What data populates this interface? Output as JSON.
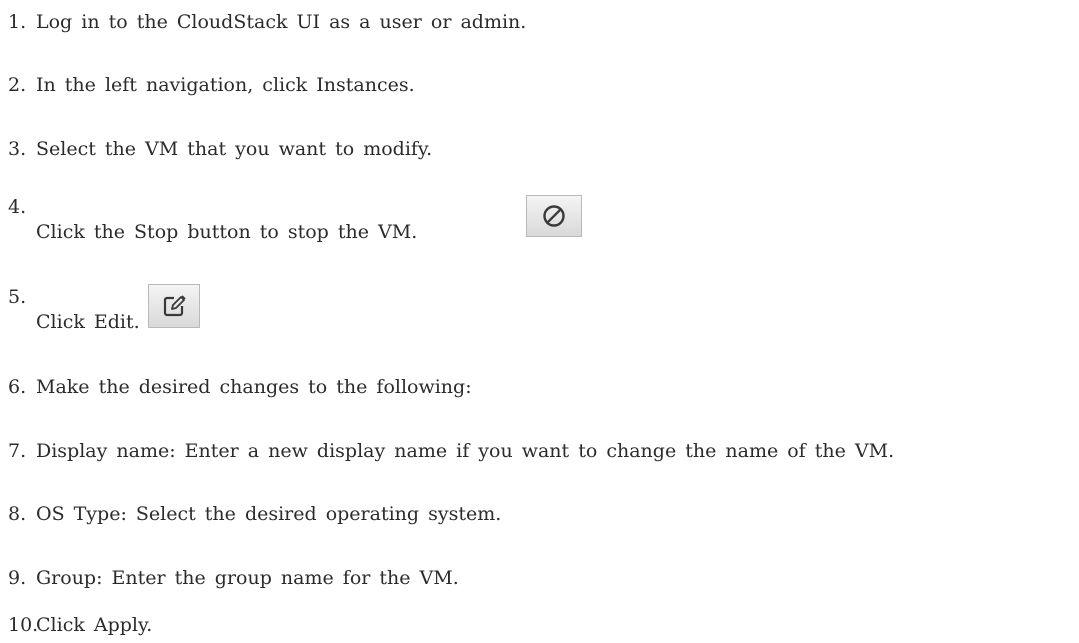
{
  "steps": [
    {
      "number": "1.",
      "text": "Log in to the CloudStack UI as a user or admin."
    },
    {
      "number": "2.",
      "text": "In the left navigation, click Instances."
    },
    {
      "number": "3.",
      "text": "Select the VM that you want to modify."
    },
    {
      "number": "4.",
      "text": "Click the Stop button to stop the VM.",
      "icon": "stop-icon"
    },
    {
      "number": "5.",
      "text": "Click Edit.",
      "icon": "edit-icon"
    },
    {
      "number": "6.",
      "text": "Make the desired changes to the following:"
    },
    {
      "number": "7.",
      "text": "Display name: Enter a new display name if you want to change the name of the VM."
    },
    {
      "number": "8.",
      "text": "OS Type: Select the desired operating system."
    },
    {
      "number": "9.",
      "text": "Group: Enter the group name for the VM."
    },
    {
      "number": "10.",
      "text": "Click Apply."
    }
  ]
}
